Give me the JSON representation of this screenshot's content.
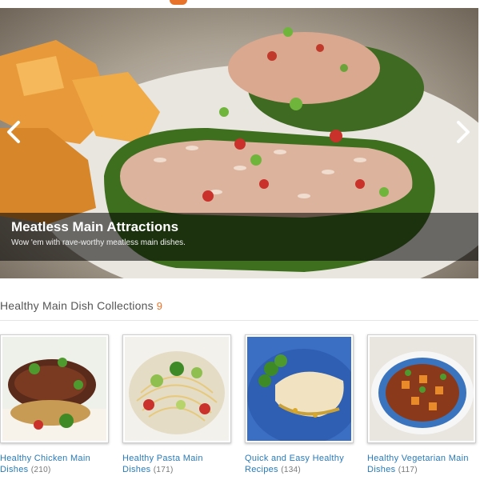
{
  "hero": {
    "title": "Meatless Main Attractions",
    "subtitle": "Wow 'em with rave-worthy meatless main dishes.",
    "prev_icon": "chevron-left-icon",
    "next_icon": "chevron-right-icon"
  },
  "section": {
    "title": "Healthy Main Dish Collections",
    "count": "9"
  },
  "collections": [
    {
      "label": "Healthy Chicken Main Dishes",
      "count": "(210)"
    },
    {
      "label": "Healthy Pasta Main Dishes",
      "count": "(171)"
    },
    {
      "label": "Quick and Easy Healthy Recipes",
      "count": "(134)"
    },
    {
      "label": "Healthy Vegetarian Main Dishes",
      "count": "(117)"
    }
  ],
  "colors": {
    "accent": "#e8742b",
    "link": "#2a7ab8"
  }
}
